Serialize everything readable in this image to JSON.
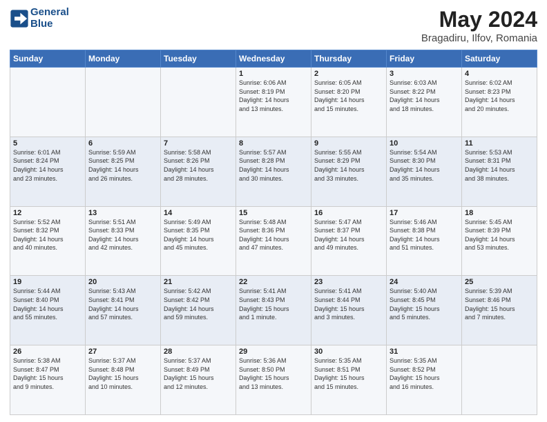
{
  "header": {
    "logo_line1": "General",
    "logo_line2": "Blue",
    "month_title": "May 2024",
    "location": "Bragadiru, Ilfov, Romania"
  },
  "days_of_week": [
    "Sunday",
    "Monday",
    "Tuesday",
    "Wednesday",
    "Thursday",
    "Friday",
    "Saturday"
  ],
  "weeks": [
    [
      {
        "num": "",
        "info": ""
      },
      {
        "num": "",
        "info": ""
      },
      {
        "num": "",
        "info": ""
      },
      {
        "num": "1",
        "info": "Sunrise: 6:06 AM\nSunset: 8:19 PM\nDaylight: 14 hours\nand 13 minutes."
      },
      {
        "num": "2",
        "info": "Sunrise: 6:05 AM\nSunset: 8:20 PM\nDaylight: 14 hours\nand 15 minutes."
      },
      {
        "num": "3",
        "info": "Sunrise: 6:03 AM\nSunset: 8:22 PM\nDaylight: 14 hours\nand 18 minutes."
      },
      {
        "num": "4",
        "info": "Sunrise: 6:02 AM\nSunset: 8:23 PM\nDaylight: 14 hours\nand 20 minutes."
      }
    ],
    [
      {
        "num": "5",
        "info": "Sunrise: 6:01 AM\nSunset: 8:24 PM\nDaylight: 14 hours\nand 23 minutes."
      },
      {
        "num": "6",
        "info": "Sunrise: 5:59 AM\nSunset: 8:25 PM\nDaylight: 14 hours\nand 26 minutes."
      },
      {
        "num": "7",
        "info": "Sunrise: 5:58 AM\nSunset: 8:26 PM\nDaylight: 14 hours\nand 28 minutes."
      },
      {
        "num": "8",
        "info": "Sunrise: 5:57 AM\nSunset: 8:28 PM\nDaylight: 14 hours\nand 30 minutes."
      },
      {
        "num": "9",
        "info": "Sunrise: 5:55 AM\nSunset: 8:29 PM\nDaylight: 14 hours\nand 33 minutes."
      },
      {
        "num": "10",
        "info": "Sunrise: 5:54 AM\nSunset: 8:30 PM\nDaylight: 14 hours\nand 35 minutes."
      },
      {
        "num": "11",
        "info": "Sunrise: 5:53 AM\nSunset: 8:31 PM\nDaylight: 14 hours\nand 38 minutes."
      }
    ],
    [
      {
        "num": "12",
        "info": "Sunrise: 5:52 AM\nSunset: 8:32 PM\nDaylight: 14 hours\nand 40 minutes."
      },
      {
        "num": "13",
        "info": "Sunrise: 5:51 AM\nSunset: 8:33 PM\nDaylight: 14 hours\nand 42 minutes."
      },
      {
        "num": "14",
        "info": "Sunrise: 5:49 AM\nSunset: 8:35 PM\nDaylight: 14 hours\nand 45 minutes."
      },
      {
        "num": "15",
        "info": "Sunrise: 5:48 AM\nSunset: 8:36 PM\nDaylight: 14 hours\nand 47 minutes."
      },
      {
        "num": "16",
        "info": "Sunrise: 5:47 AM\nSunset: 8:37 PM\nDaylight: 14 hours\nand 49 minutes."
      },
      {
        "num": "17",
        "info": "Sunrise: 5:46 AM\nSunset: 8:38 PM\nDaylight: 14 hours\nand 51 minutes."
      },
      {
        "num": "18",
        "info": "Sunrise: 5:45 AM\nSunset: 8:39 PM\nDaylight: 14 hours\nand 53 minutes."
      }
    ],
    [
      {
        "num": "19",
        "info": "Sunrise: 5:44 AM\nSunset: 8:40 PM\nDaylight: 14 hours\nand 55 minutes."
      },
      {
        "num": "20",
        "info": "Sunrise: 5:43 AM\nSunset: 8:41 PM\nDaylight: 14 hours\nand 57 minutes."
      },
      {
        "num": "21",
        "info": "Sunrise: 5:42 AM\nSunset: 8:42 PM\nDaylight: 14 hours\nand 59 minutes."
      },
      {
        "num": "22",
        "info": "Sunrise: 5:41 AM\nSunset: 8:43 PM\nDaylight: 15 hours\nand 1 minute."
      },
      {
        "num": "23",
        "info": "Sunrise: 5:41 AM\nSunset: 8:44 PM\nDaylight: 15 hours\nand 3 minutes."
      },
      {
        "num": "24",
        "info": "Sunrise: 5:40 AM\nSunset: 8:45 PM\nDaylight: 15 hours\nand 5 minutes."
      },
      {
        "num": "25",
        "info": "Sunrise: 5:39 AM\nSunset: 8:46 PM\nDaylight: 15 hours\nand 7 minutes."
      }
    ],
    [
      {
        "num": "26",
        "info": "Sunrise: 5:38 AM\nSunset: 8:47 PM\nDaylight: 15 hours\nand 9 minutes."
      },
      {
        "num": "27",
        "info": "Sunrise: 5:37 AM\nSunset: 8:48 PM\nDaylight: 15 hours\nand 10 minutes."
      },
      {
        "num": "28",
        "info": "Sunrise: 5:37 AM\nSunset: 8:49 PM\nDaylight: 15 hours\nand 12 minutes."
      },
      {
        "num": "29",
        "info": "Sunrise: 5:36 AM\nSunset: 8:50 PM\nDaylight: 15 hours\nand 13 minutes."
      },
      {
        "num": "30",
        "info": "Sunrise: 5:35 AM\nSunset: 8:51 PM\nDaylight: 15 hours\nand 15 minutes."
      },
      {
        "num": "31",
        "info": "Sunrise: 5:35 AM\nSunset: 8:52 PM\nDaylight: 15 hours\nand 16 minutes."
      },
      {
        "num": "",
        "info": ""
      }
    ]
  ]
}
